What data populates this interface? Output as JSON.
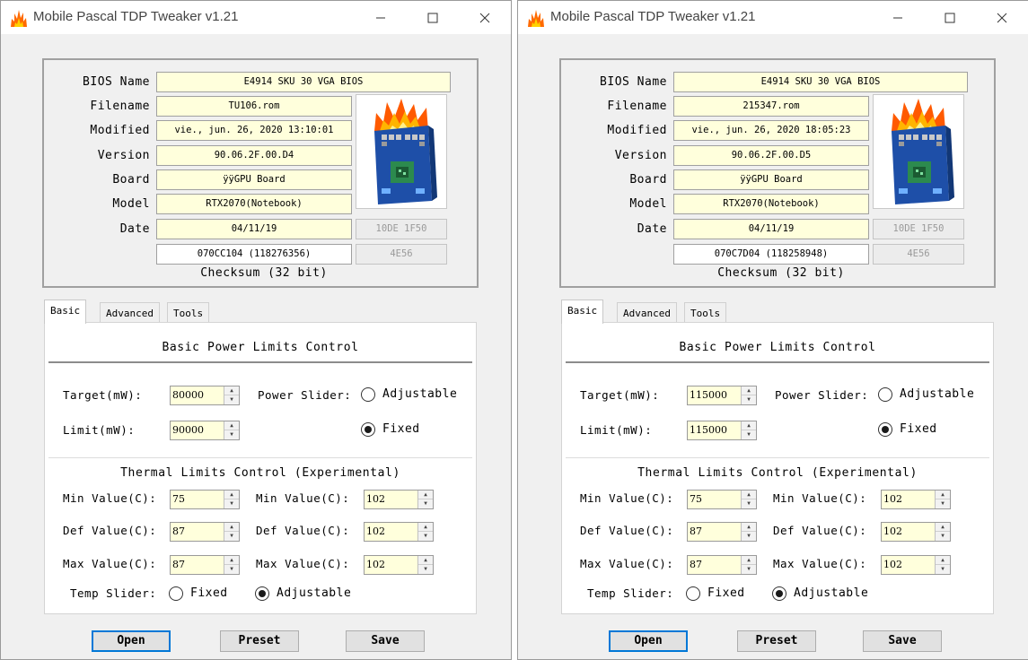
{
  "windows": [
    {
      "title": "Mobile Pascal TDP Tweaker v1.21",
      "bios": {
        "bios_name_label": "BIOS Name",
        "bios_name": "E4914 SKU 30 VGA BIOS",
        "filename_label": "Filename",
        "filename": "TU106.rom",
        "modified_label": "Modified",
        "modified": "vie., jun. 26, 2020 13:10:01",
        "version_label": "Version",
        "version": "90.06.2F.00.D4",
        "board_label": "Board",
        "board": "ÿÿGPU Board",
        "model_label": "Model",
        "model": "RTX2070(Notebook)",
        "date_label": "Date",
        "date": "04/11/19",
        "device_id": "10DE 1F50",
        "checksum": "070CC104 (118276356)",
        "checksum_short": "4E56",
        "checksum_label": "Checksum (32 bit)"
      },
      "tabs": [
        "Basic",
        "Advanced",
        "Tools"
      ],
      "basic": {
        "power_title": "Basic Power Limits Control",
        "target_label": "Target(mW):",
        "target": "80000",
        "limit_label": "Limit(mW):",
        "limit": "90000",
        "power_slider_label": "Power Slider:",
        "adjustable": "Adjustable",
        "fixed": "Fixed",
        "power_slider_mode": "Fixed"
      },
      "thermal": {
        "title": "Thermal Limits Control (Experimental)",
        "min_label": "Min Value(C):",
        "def_label": "Def Value(C):",
        "max_label": "Max Value(C):",
        "min_l": "75",
        "def_l": "87",
        "max_l": "87",
        "min_r": "102",
        "def_r": "102",
        "max_r": "102",
        "temp_slider_label": "Temp Slider:",
        "fixed": "Fixed",
        "adjustable": "Adjustable",
        "temp_slider_mode": "Adjustable"
      },
      "buttons": {
        "open": "Open",
        "preset": "Preset",
        "save": "Save"
      }
    },
    {
      "title": "Mobile Pascal TDP Tweaker v1.21",
      "bios": {
        "bios_name_label": "BIOS Name",
        "bios_name": "E4914 SKU 30 VGA BIOS",
        "filename_label": "Filename",
        "filename": "215347.rom",
        "modified_label": "Modified",
        "modified": "vie., jun. 26, 2020 18:05:23",
        "version_label": "Version",
        "version": "90.06.2F.00.D5",
        "board_label": "Board",
        "board": "ÿÿGPU Board",
        "model_label": "Model",
        "model": "RTX2070(Notebook)",
        "date_label": "Date",
        "date": "04/11/19",
        "device_id": "10DE 1F50",
        "checksum": "070C7D04 (118258948)",
        "checksum_short": "4E56",
        "checksum_label": "Checksum (32 bit)"
      },
      "tabs": [
        "Basic",
        "Advanced",
        "Tools"
      ],
      "basic": {
        "power_title": "Basic Power Limits Control",
        "target_label": "Target(mW):",
        "target": "115000",
        "limit_label": "Limit(mW):",
        "limit": "115000",
        "power_slider_label": "Power Slider:",
        "adjustable": "Adjustable",
        "fixed": "Fixed",
        "power_slider_mode": "Fixed"
      },
      "thermal": {
        "title": "Thermal Limits Control (Experimental)",
        "min_label": "Min Value(C):",
        "def_label": "Def Value(C):",
        "max_label": "Max Value(C):",
        "min_l": "75",
        "def_l": "87",
        "max_l": "87",
        "min_r": "102",
        "def_r": "102",
        "max_r": "102",
        "temp_slider_label": "Temp Slider:",
        "fixed": "Fixed",
        "adjustable": "Adjustable",
        "temp_slider_mode": "Adjustable"
      },
      "buttons": {
        "open": "Open",
        "preset": "Preset",
        "save": "Save"
      }
    }
  ],
  "icons": {
    "app": "flame-icon",
    "minimize": "minimize-icon",
    "maximize": "maximize-icon",
    "close": "close-icon",
    "logo": "gpu-chip-on-fire-icon"
  },
  "colors": {
    "field_yellow": "#ffffdc",
    "default_button_border": "#0078d7",
    "flame_orange": "#ff7a00",
    "board_blue": "#1e4fa8",
    "chip_green": "#2c8a4e"
  }
}
